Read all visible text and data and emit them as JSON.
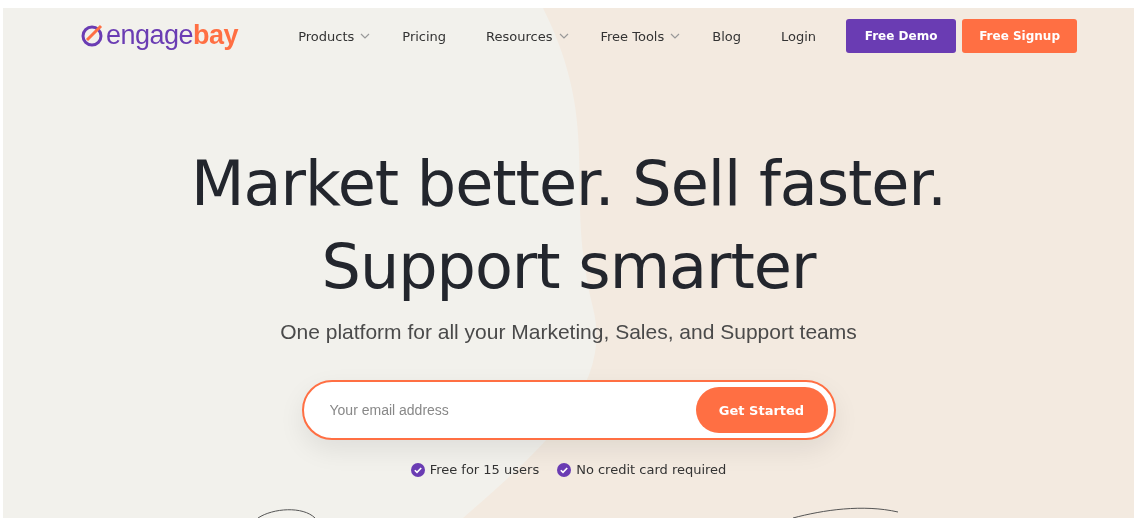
{
  "logo": {
    "prefix": "engage",
    "suffix": "bay"
  },
  "nav": [
    {
      "label": "Products",
      "kind": "dropdown"
    },
    {
      "label": "Pricing",
      "kind": "link"
    },
    {
      "label": "Resources",
      "kind": "dropdown"
    },
    {
      "label": "Free Tools",
      "kind": "dropdown"
    },
    {
      "label": "Blog",
      "kind": "link"
    },
    {
      "label": "Login",
      "kind": "link"
    }
  ],
  "nav_buttons": [
    {
      "label": "Free Demo",
      "kind": "primary"
    },
    {
      "label": "Free Signup",
      "kind": "accent"
    }
  ],
  "hero": {
    "title_lines": [
      "Market better. Sell faster.",
      "Support smarter"
    ],
    "subtitle": "One platform for all your Marketing, Sales, and Support teams",
    "email": {
      "placeholder": "Your email address"
    },
    "cta": "Get Started",
    "perks": [
      "Free for 15 users",
      "No credit card required"
    ]
  }
}
